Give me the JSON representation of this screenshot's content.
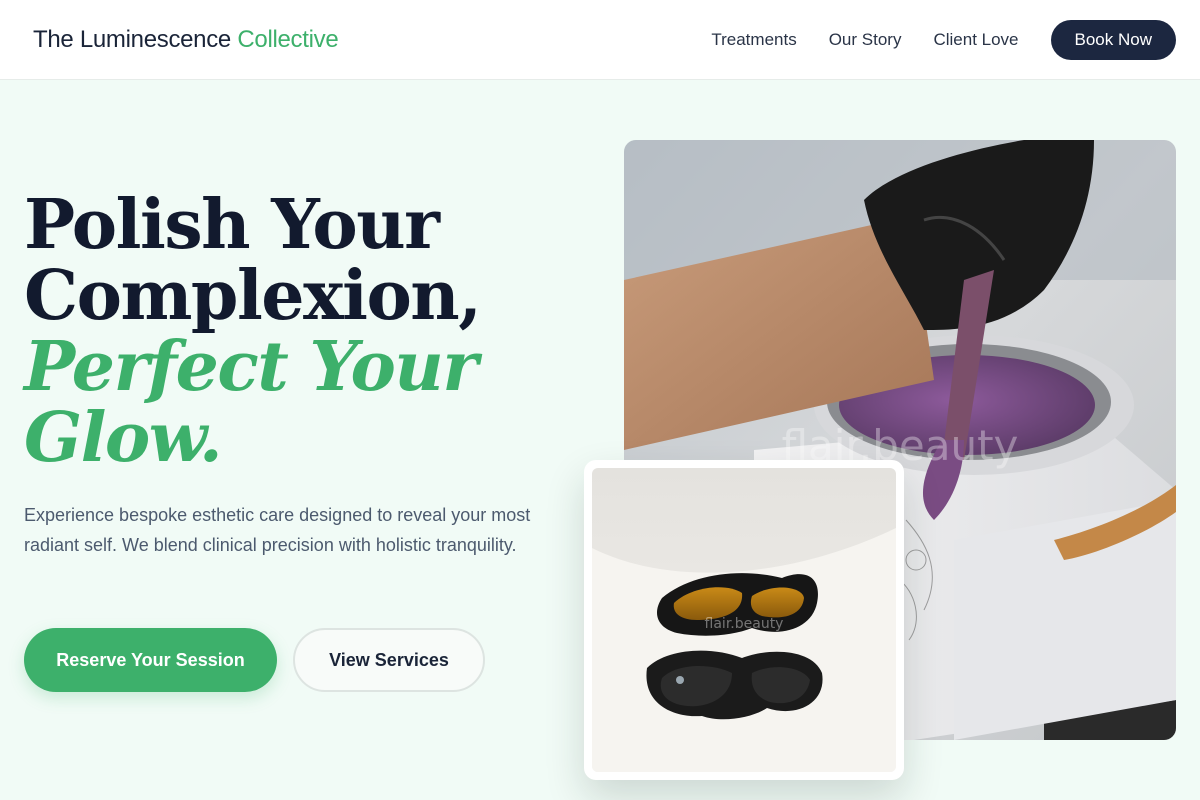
{
  "header": {
    "logo_main": "The Luminescence",
    "logo_accent": "Collective",
    "nav": [
      "Treatments",
      "Our Story",
      "Client Love"
    ],
    "cta_label": "Book Now"
  },
  "hero": {
    "title_line1": "Polish Your",
    "title_line2": "Complexion,",
    "title_line3": "Perfect Your",
    "title_line4": "Glow.",
    "description": "Experience bespoke esthetic care designed to reveal your most radiant self. We blend clinical precision with holistic tranquility.",
    "primary_button": "Reserve Your Session",
    "secondary_button": "View Services"
  },
  "images": {
    "main_watermark": "flair.beauty",
    "inset_watermark": "flair.beauty"
  },
  "colors": {
    "accent": "#3db06b",
    "navy": "#1c2740",
    "background": "#f1fbf6"
  }
}
